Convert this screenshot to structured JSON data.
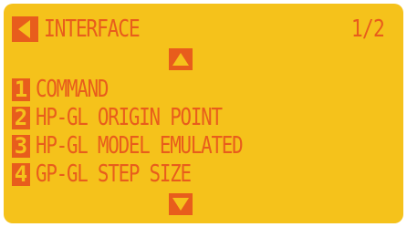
{
  "header": {
    "back_icon": "back-arrow-icon",
    "title": "INTERFACE",
    "page_indicator": "1/2"
  },
  "scroll": {
    "up_icon": "scroll-up-arrow-icon",
    "down_icon": "scroll-down-arrow-icon"
  },
  "menu": {
    "items": [
      {
        "number": "1",
        "label": "COMMAND"
      },
      {
        "number": "2",
        "label": "HP-GL ORIGIN POINT"
      },
      {
        "number": "3",
        "label": "HP-GL MODEL EMULATED"
      },
      {
        "number": "4",
        "label": "GP-GL STEP SIZE"
      }
    ]
  },
  "colors": {
    "background": "#f5c21b",
    "accent": "#e85d1c"
  }
}
